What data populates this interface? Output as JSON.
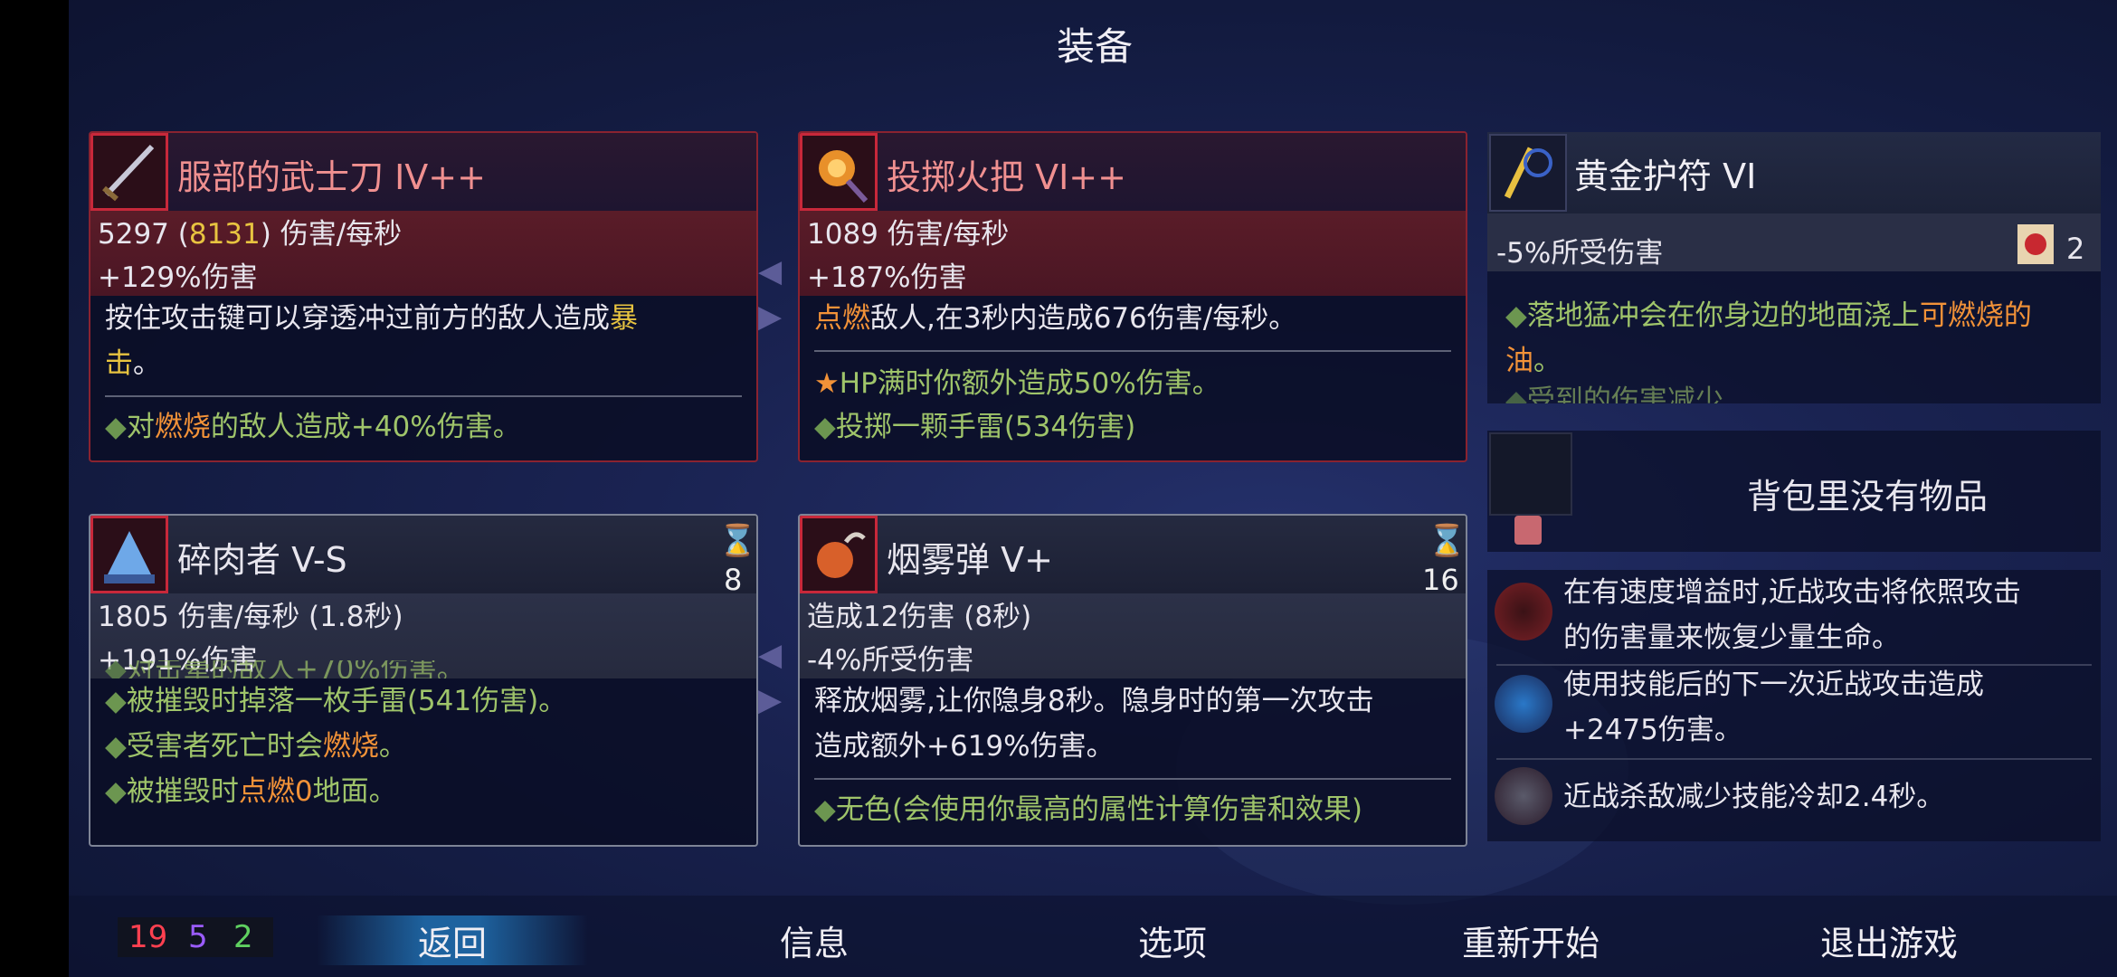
{
  "title": "装备",
  "cards": {
    "katana": {
      "name": "服部的武士刀 IV++",
      "dps_base": "5297 (",
      "dps_bonus": "8131",
      "dps_unit": ") 伤害/每秒",
      "dmg": "+129%伤害",
      "desc_a": "按住攻击键可以穿透冲过前方的敌人造成",
      "desc_hl1": "暴",
      "desc_hl2": "击",
      "desc_end": "。",
      "mod_a": "对",
      "mod_hl": "燃烧",
      "mod_b": "的敌人造成+40%伤害。"
    },
    "torch": {
      "name": "投掷火把 VI++",
      "dps": "1089 伤害/每秒",
      "dmg": "+187%伤害",
      "desc_hl": "点燃",
      "desc_b": "敌人,在3秒内造成676伤害/每秒。",
      "mod1": "HP满时你额外造成50%伤害。",
      "mod2": "投掷一颗手雷(534伤害)"
    },
    "amulet": {
      "name": "黄金护符 VI",
      "stat": "-5%所受伤害",
      "scroll_count": "2",
      "mod_a": "落地猛冲会在你身边的地面浇上",
      "mod_hl1": "可燃烧的",
      "mod_hl2": "油",
      "mod_end": "。",
      "mod_cut": "受到的伤害减少"
    },
    "meatgrinder": {
      "name": "碎肉者 V-S",
      "count": "8",
      "dps": "1805 伤害/每秒 (1.8秒)",
      "dmg": "+191%伤害",
      "cut_line": "对击晕的敌人+70%伤害。",
      "mod1": "被摧毁时掉落一枚手雷(541伤害)。",
      "mod2_a": "受害者死亡时会",
      "mod2_hl": "燃烧",
      "mod2_end": "。",
      "mod3_a": "被摧毁时",
      "mod3_hl": "点燃0",
      "mod3_end": "地面。"
    },
    "smoke": {
      "name": "烟雾弹 V+",
      "count": "16",
      "line1": "造成12伤害 (8秒)",
      "line2": "-4%所受伤害",
      "desc1": "释放烟雾,让你隐身8秒。隐身时的第一次攻击",
      "desc2": "造成额外+619%伤害。",
      "mod": "无色(会使用你最高的属性计算伤害和效果)"
    }
  },
  "backpack": {
    "empty_text": "背包里没有物品"
  },
  "mutations": [
    {
      "text1": "在有速度增益时,近战攻击将依照攻击",
      "text2": "的伤害量来恢复少量生命。"
    },
    {
      "text1": "使用技能后的下一次近战攻击造成",
      "text2": "+2475伤害。"
    },
    {
      "text1": "近战杀敌减少技能冷却2.4秒。"
    }
  ],
  "scrolls": {
    "red": "19",
    "purple": "5",
    "green": "2"
  },
  "nav": {
    "back": "返回",
    "info": "信息",
    "options": "选项",
    "restart": "重新开始",
    "quit": "退出游戏"
  },
  "colors": {
    "brutality": "#ff4050",
    "tactics": "#9b5cff",
    "survival": "#5fd060",
    "nav_highlight": "#2896e6"
  }
}
